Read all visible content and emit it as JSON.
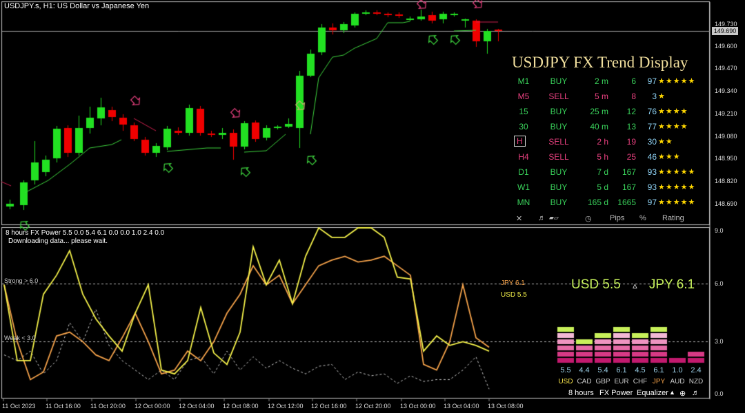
{
  "window": {
    "chart_title": "USDJPY.s, H1:  US Dollar vs Japanese Yen"
  },
  "price_axis": {
    "labels": [
      "149.730",
      "149.690",
      "149.600",
      "149.470",
      "149.340",
      "149.210",
      "149.080",
      "148.950",
      "148.820",
      "148.690"
    ],
    "current_price": "149.690",
    "min": 148.62,
    "max": 149.82
  },
  "time_axis": {
    "labels": [
      "11 Oct 2023",
      "11 Oct 16:00",
      "11 Oct 20:00",
      "12 Oct 00:00",
      "12 Oct 04:00",
      "12 Oct 08:00",
      "12 Oct 12:00",
      "12 Oct 16:00",
      "12 Oct 20:00",
      "13 Oct 00:00",
      "13 Oct 04:00",
      "13 Oct 08:00"
    ]
  },
  "trend_display": {
    "title": "USDJPY FX Trend Display",
    "rows": [
      {
        "tf": "M1",
        "dir": "BUY",
        "time": "2 m",
        "pips": "6",
        "pct": "97",
        "stars": "★★★★★",
        "color": "#39d05a",
        "boxed": false
      },
      {
        "tf": "M5",
        "dir": "SELL",
        "time": "5 m",
        "pips": "8",
        "pct": "3",
        "stars": "★",
        "color": "#e8407f",
        "boxed": false
      },
      {
        "tf": "15",
        "dir": "BUY",
        "time": "25 m",
        "pips": "12",
        "pct": "76",
        "stars": "★★★★",
        "color": "#39d05a",
        "boxed": false
      },
      {
        "tf": "30",
        "dir": "BUY",
        "time": "40 m",
        "pips": "13",
        "pct": "77",
        "stars": "★★★★",
        "color": "#39d05a",
        "boxed": false
      },
      {
        "tf": "H",
        "dir": "SELL",
        "time": "2 h",
        "pips": "19",
        "pct": "30",
        "stars": "★★",
        "color": "#e8407f",
        "boxed": true
      },
      {
        "tf": "H4",
        "dir": "SELL",
        "time": "5 h",
        "pips": "25",
        "pct": "46",
        "stars": "★★★",
        "color": "#e8407f",
        "boxed": false
      },
      {
        "tf": "D1",
        "dir": "BUY",
        "time": "7 d",
        "pips": "167",
        "pct": "93",
        "stars": "★★★★★",
        "color": "#39d05a",
        "boxed": false
      },
      {
        "tf": "W1",
        "dir": "BUY",
        "time": "5 d",
        "pips": "167",
        "pct": "93",
        "stars": "★★★★★",
        "color": "#39d05a",
        "boxed": false
      },
      {
        "tf": "MN",
        "dir": "BUY",
        "time": "165 d",
        "pips": "1665",
        "pct": "97",
        "stars": "★★★★★",
        "color": "#39d05a",
        "boxed": false
      }
    ],
    "footer": {
      "close": "✕",
      "sound": "♬",
      "pips": "Pips",
      "percent": "%",
      "rating": "Rating"
    }
  },
  "indicator": {
    "title": "8 hours FX Power 5.5 0.0 5.4 6.1 0.0 0.0 1.0 2.4 0.0",
    "status": "Downloading data... please wait.",
    "strong_label": "Strong > 6.0",
    "weak_label": "Weak < 3.0",
    "axis_labels": [
      "9.0",
      "6.0",
      "3.0",
      "0.0"
    ],
    "jpy_label": "JPY 6.1",
    "usd_label": "USD 5.5",
    "pair_usd": "USD 5.5",
    "pair_arrow": "▵",
    "pair_jpy": "JPY 6.1",
    "equalizer": {
      "values": [
        "5.5",
        "4.4",
        "5.4",
        "6.1",
        "4.5",
        "6.1",
        "1.0",
        "2.4"
      ],
      "currencies": [
        "USD",
        "CAD",
        "GBP",
        "EUR",
        "CHF",
        "JPY",
        "AUD",
        "NZD"
      ],
      "levels": [
        5.5,
        4.4,
        5.4,
        6.1,
        4.5,
        6.1,
        1.0,
        2.4
      ],
      "footer_period": "8 hours",
      "footer_name": "FX Power",
      "footer_mode": "Equalizer"
    },
    "colors": {
      "usd": "#f5f24a",
      "jpy": "#f5a24a",
      "grey": "#cccccc"
    }
  },
  "chart_data": {
    "type": "line",
    "title": "8 hours FX Power",
    "ylim": [
      0,
      9
    ],
    "series": [
      {
        "name": "USD",
        "values": [
          6.0,
          2.0,
          2.0,
          5.5,
          6.5,
          7.8,
          5.5,
          4.2,
          3.3,
          2.5,
          4.5,
          6.0,
          1.5,
          1.3,
          2.0,
          4.8,
          2.4,
          1.8,
          3.5,
          8.0,
          6.0,
          7.3,
          5.0,
          7.5,
          9.0,
          8.5,
          8.5,
          9.0,
          9.0,
          8.5,
          6.4,
          6.3,
          2.5,
          3.3,
          2.8,
          3.0,
          2.8,
          2.5
        ]
      },
      {
        "name": "JPY",
        "values": [
          6.0,
          3.0,
          1.0,
          1.4,
          3.3,
          3.5,
          3.0,
          2.3,
          2.0,
          3.2,
          4.5,
          3.0,
          1.3,
          1.5,
          2.5,
          2.0,
          3.0,
          4.5,
          5.5,
          7.0,
          6.0,
          6.5,
          5.0,
          6.0,
          7.0,
          7.3,
          7.5,
          7.2,
          7.3,
          7.5,
          7.0,
          6.5,
          1.8,
          1.5,
          3.0,
          6.0,
          3.2,
          2.7
        ]
      },
      {
        "name": "",
        "values": [
          2.3,
          2.0,
          2.5,
          1.3,
          2.0,
          4.0,
          3.0,
          4.7,
          2.8,
          2.0,
          1.5,
          1.0,
          1.5,
          1.0,
          2.0,
          2.2,
          1.3,
          2.5,
          1.5,
          2.2,
          1.6,
          2.0,
          1.6,
          1.3,
          1.7,
          1.8,
          1.0,
          1.4,
          1.2,
          1.3,
          0.8,
          1.2,
          0.9,
          1.0,
          1.0,
          1.5,
          2.2,
          0.5
        ]
      }
    ]
  }
}
